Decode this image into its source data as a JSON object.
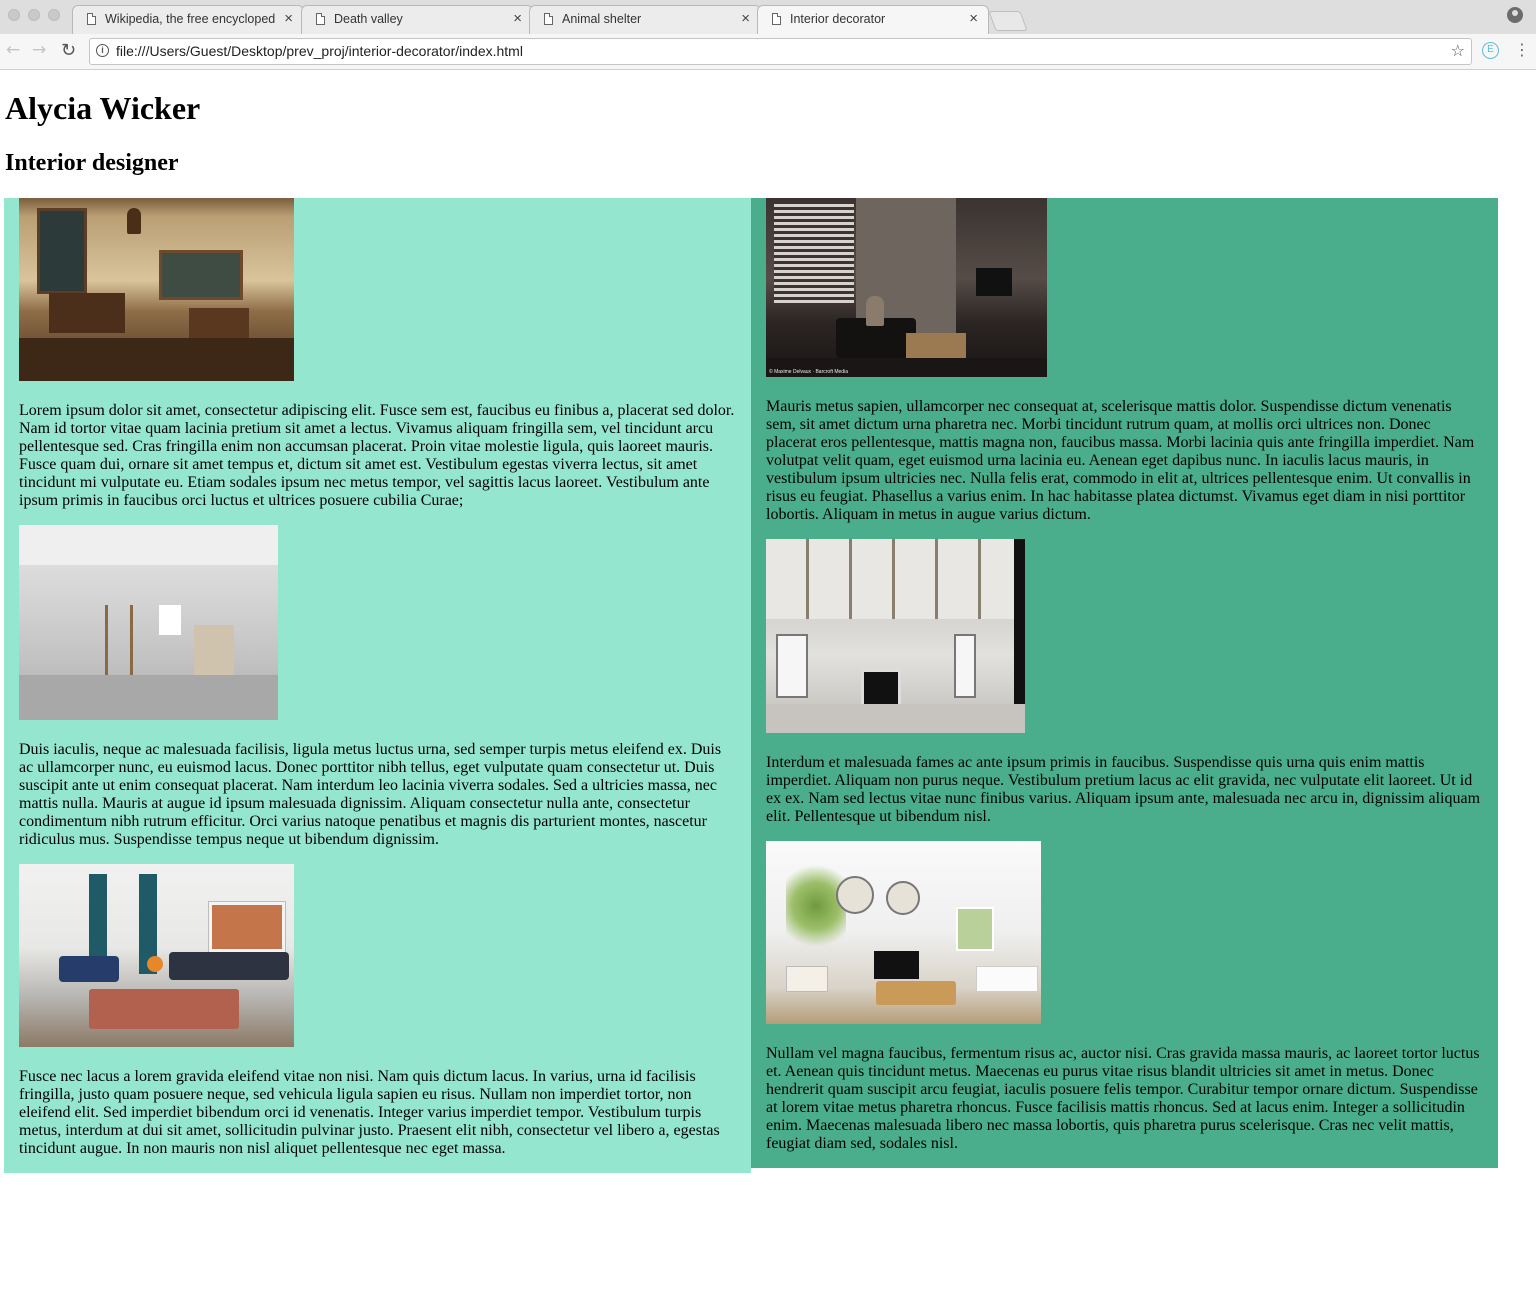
{
  "browser": {
    "tabs": [
      {
        "title": "Wikipedia, the free encyclopedia",
        "active": false
      },
      {
        "title": "Death valley",
        "active": false
      },
      {
        "title": "Animal shelter",
        "active": false
      },
      {
        "title": "Interior decorator",
        "active": true
      }
    ],
    "url": "file:///Users/Guest/Desktop/prev_proj/interior-decorator/index.html",
    "ext_label": "E"
  },
  "page": {
    "name": "Alycia Wicker",
    "subtitle": "Interior designer",
    "left_column": [
      {
        "image": "classroom-photo",
        "text": "Lorem ipsum dolor sit amet, consectetur adipiscing elit. Fusce sem est, faucibus eu finibus a, placerat sed dolor. Nam id tortor vitae quam lacinia pretium sit amet a lectus. Vivamus aliquam fringilla sem, vel tincidunt arcu pellentesque sed. Cras fringilla enim non accumsan placerat. Proin vitae molestie ligula, quis laoreet mauris. Fusce quam dui, ornare sit amet tempus et, dictum sit amet est. Vestibulum egestas viverra lectus, sit amet tincidunt mi vulputate eu. Etiam sodales ipsum nec metus tempor, vel sagittis lacus laoreet. Vestibulum ante ipsum primis in faucibus orci luctus et ultrices posuere cubilia Curae;"
      },
      {
        "image": "drywall-room-photo",
        "text": "Duis iaculis, neque ac malesuada facilisis, ligula metus luctus urna, sed semper turpis metus eleifend ex. Duis ac ullamcorper nunc, eu euismod lacus. Donec porttitor nibh tellus, eget vulputate quam consectetur ut. Duis suscipit ante ut enim consequat placerat. Nam interdum leo lacinia viverra sodales. Sed a ultricies massa, nec mattis nulla. Mauris at augue id ipsum malesuada dignissim. Aliquam consectetur nulla ante, consectetur condimentum nibh rutrum efficitur. Orci varius natoque penatibus et magnis dis parturient montes, nascetur ridiculus mus. Suspendisse tempus neque ut bibendum dignissim."
      },
      {
        "image": "living-room-blue-sofa-photo",
        "text": "Fusce nec lacus a lorem gravida eleifend vitae non nisi. Nam quis dictum lacus. In varius, urna id facilisis fringilla, justo quam posuere neque, sed vehicula ligula sapien eu risus. Nullam non imperdiet tortor, non eleifend elit. Sed imperdiet bibendum orci id venenatis. Integer varius imperdiet tempor. Vestibulum turpis metus, interdum at dui sit amet, sollicitudin pulvinar justo. Praesent elit nibh, consectetur vel libero a, egestas tincidunt augue. In non mauris non nisl aliquet pellentesque nec eget massa."
      }
    ],
    "right_column": [
      {
        "image": "dark-living-room-photo",
        "caption": "© Maxime Delvaux · Barcroft Media",
        "text": "Mauris metus sapien, ullamcorper nec consequat at, scelerisque mattis dolor. Suspendisse dictum venenatis sem, sit amet dictum urna pharetra nec. Morbi tincidunt rutrum quam, at mollis orci ultrices non. Donec placerat eros pellentesque, mattis magna non, faucibus massa. Morbi lacinia quis ante fringilla imperdiet. Nam volutpat velit quam, eget euismod urna lacinia eu. Aenean eget dapibus nunc. In iaculis lacus mauris, in vestibulum ipsum ultricies nec. Nulla felis erat, commodo in elit at, ultrices pellentesque enim. Ut convallis in risus eu feugiat. Phasellus a varius enim. In hac habitasse platea dictumst. Vivamus eget diam in nisi porttitor lobortis. Aliquam in metus in augue varius dictum."
      },
      {
        "image": "coffered-ceiling-room-photo",
        "text": "Interdum et malesuada fames ac ante ipsum primis in faucibus. Suspendisse quis urna quis enim mattis imperdiet. Aliquam non purus neque. Vestibulum pretium lacus ac elit gravida, nec vulputate elit laoreet. Ut id ex ex. Nam sed lectus vitae nunc finibus varius. Aliquam ipsum ante, malesuada nec arcu in, dignissim aliquam elit. Pellentesque ut bibendum nisl."
      },
      {
        "image": "white-living-room-photo",
        "text": "Nullam vel magna faucibus, fermentum risus ac, auctor nisi. Cras gravida massa mauris, ac laoreet tortor luctus et. Aenean quis tincidunt metus. Maecenas eu purus vitae risus blandit ultricies sit amet in metus. Donec hendrerit quam suscipit arcu feugiat, iaculis posuere felis tempor. Curabitur tempor ornare dictum. Suspendisse at lorem vitae metus pharetra rhoncus. Fusce facilisis mattis rhoncus. Sed at lacus enim. Integer a sollicitudin enim. Maecenas malesuada libero nec massa lobortis, quis pharetra purus scelerisque. Cras nec velit mattis, feugiat diam sed, sodales nisl."
      }
    ]
  }
}
